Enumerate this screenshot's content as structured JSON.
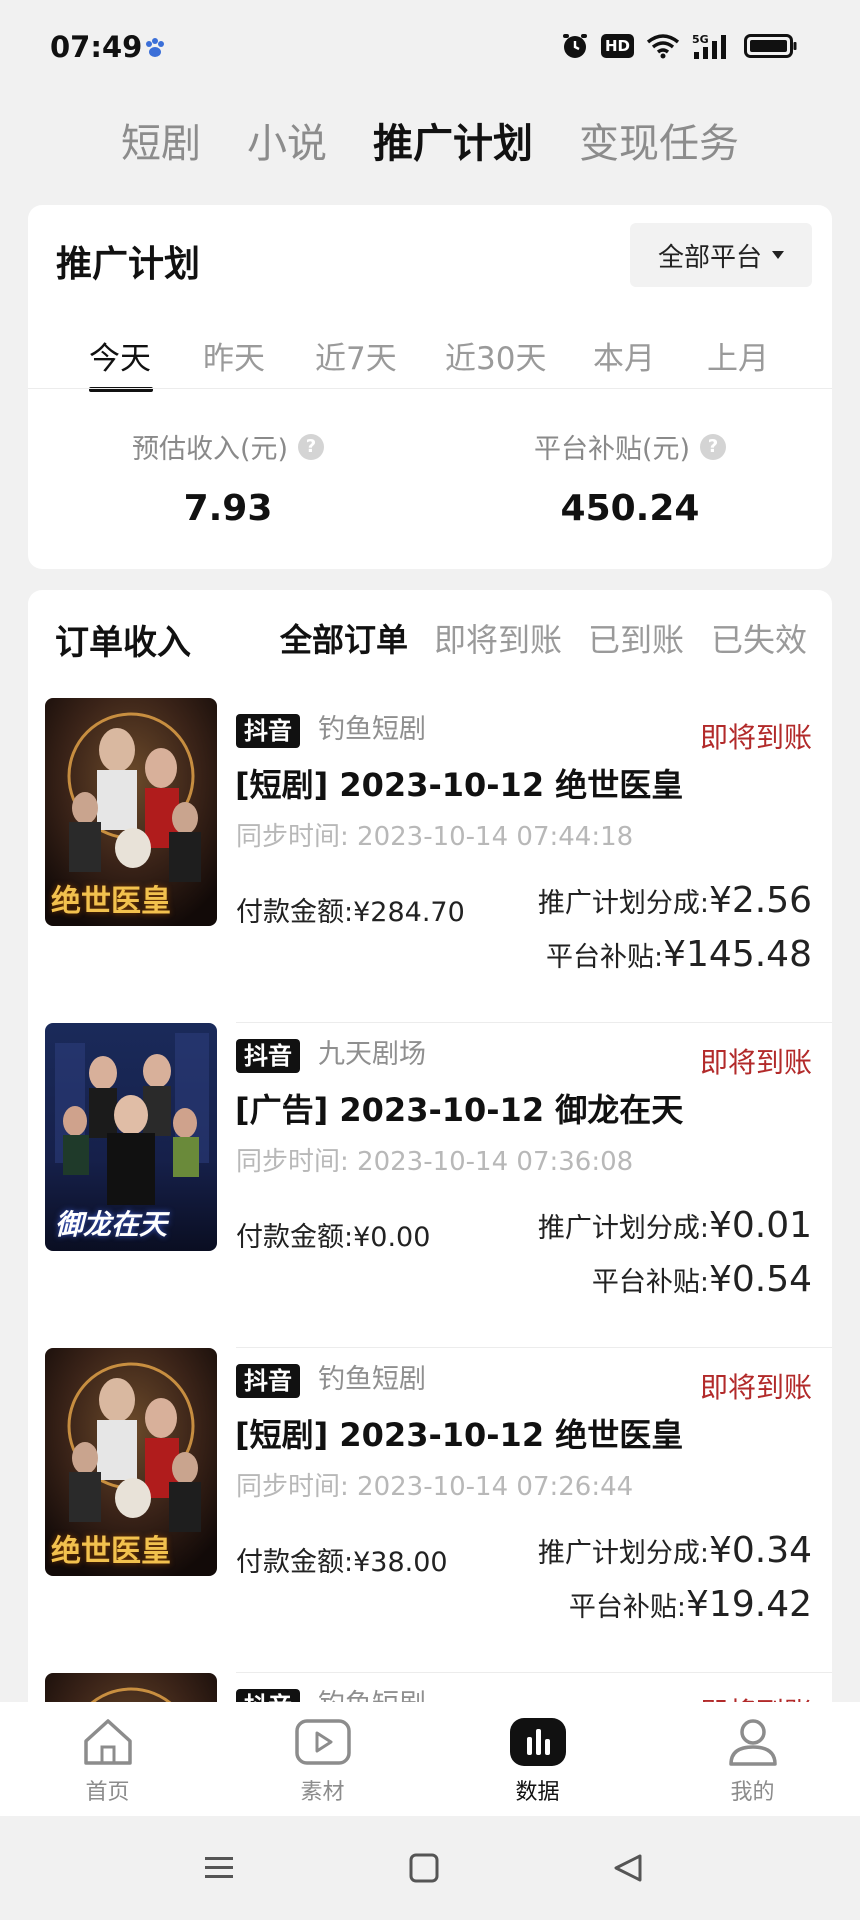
{
  "status_bar": {
    "time": "07:49",
    "app_icon": "paw-icon",
    "icons": [
      "alarm-icon",
      "hd-icon",
      "wifi-icon",
      "5g-signal-icon",
      "battery-icon"
    ],
    "hd_label": "HD",
    "net_label": "5G"
  },
  "top_tabs": [
    "短剧",
    "小说",
    "推广计划",
    "变现任务"
  ],
  "top_tabs_active": "推广计划",
  "plan_card": {
    "title": "推广计划",
    "platform_select": "全部平台",
    "date_tabs": [
      "今天",
      "昨天",
      "近7天",
      "近30天",
      "本月",
      "上月"
    ],
    "date_tabs_active": "今天",
    "metrics": {
      "estimated_income_label": "预估收入(元)",
      "estimated_income_value": "7.93",
      "platform_subsidy_label": "平台补贴(元)",
      "platform_subsidy_value": "450.24"
    }
  },
  "orders_card": {
    "title": "订单收入",
    "filter_tabs": [
      "全部订单",
      "即将到账",
      "已到账",
      "已失效"
    ],
    "filter_active": "全部订单",
    "orders": [
      {
        "platform": "抖音",
        "source": "钓鱼短剧",
        "status": "即将到账",
        "title": "[短剧] 2023-10-12 绝世医皇",
        "sync_label": "同步时间:",
        "sync_time": "2023-10-14 07:44:18",
        "pay_label": "付款金额:",
        "pay_amount": "¥284.70",
        "share_label": "推广计划分成:",
        "share_amount": "¥2.56",
        "subsidy_label": "平台补贴:",
        "subsidy_amount": "¥145.48",
        "poster_text": "绝世医皇"
      },
      {
        "platform": "抖音",
        "source": "九天剧场",
        "status": "即将到账",
        "title": "[广告] 2023-10-12 御龙在天",
        "sync_label": "同步时间:",
        "sync_time": "2023-10-14 07:36:08",
        "pay_label": "付款金额:",
        "pay_amount": "¥0.00",
        "share_label": "推广计划分成:",
        "share_amount": "¥0.01",
        "subsidy_label": "平台补贴:",
        "subsidy_amount": "¥0.54",
        "poster_text": "御龙在天"
      },
      {
        "platform": "抖音",
        "source": "钓鱼短剧",
        "status": "即将到账",
        "title": "[短剧] 2023-10-12 绝世医皇",
        "sync_label": "同步时间:",
        "sync_time": "2023-10-14 07:26:44",
        "pay_label": "付款金额:",
        "pay_amount": "¥38.00",
        "share_label": "推广计划分成:",
        "share_amount": "¥0.34",
        "subsidy_label": "平台补贴:",
        "subsidy_amount": "¥19.42",
        "poster_text": "绝世医皇"
      },
      {
        "platform": "抖音",
        "source": "钓鱼短剧",
        "status": "即将到账"
      }
    ]
  },
  "bottom_nav": [
    {
      "label": "首页",
      "icon": "home-icon"
    },
    {
      "label": "素材",
      "icon": "play-icon"
    },
    {
      "label": "数据",
      "icon": "bar-chart-icon"
    },
    {
      "label": "我的",
      "icon": "user-icon"
    }
  ],
  "bottom_nav_active": "数据",
  "system_nav": [
    "menu-icon",
    "home-square-icon",
    "back-icon"
  ],
  "colors": {
    "accent_status": "#b22a2a",
    "badge_bg": "#111111",
    "page_bg": "#f1f1f1",
    "muted_text": "#9a9a9a"
  }
}
